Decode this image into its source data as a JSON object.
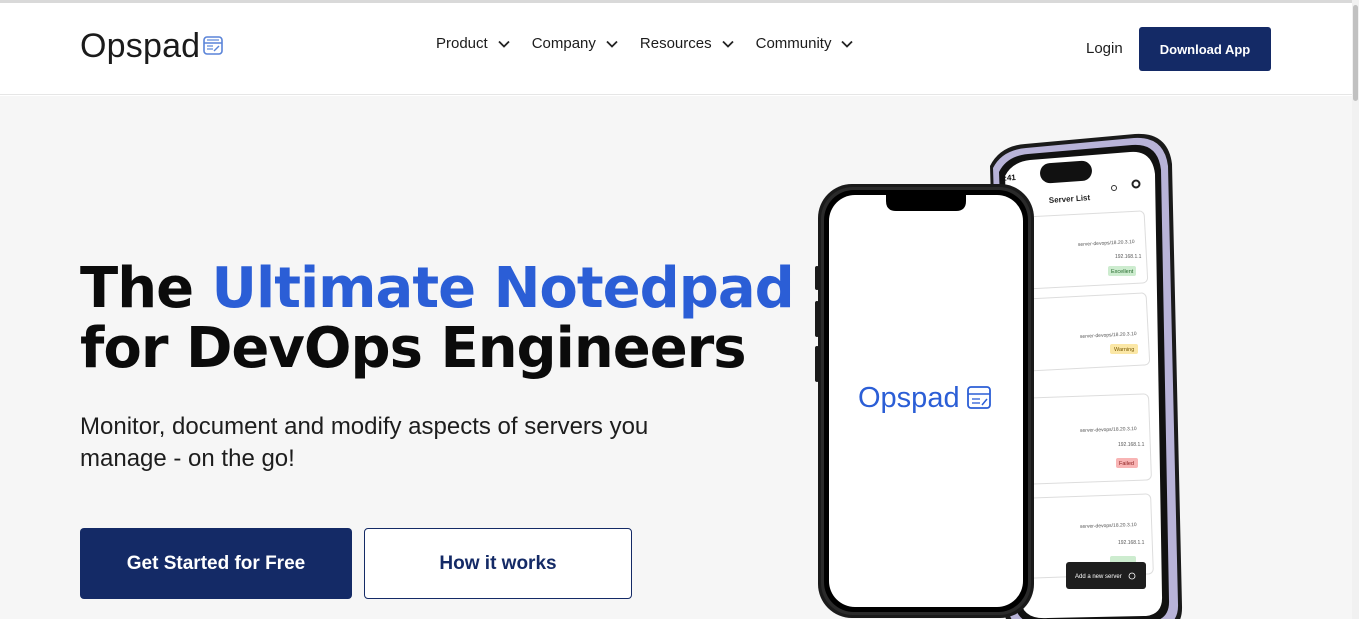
{
  "brand": {
    "name": "Opspad",
    "accent_color": "#2b5ed6",
    "primary_color": "#142a66"
  },
  "nav": {
    "items": [
      {
        "label": "Product",
        "icon": "chevron-down-icon"
      },
      {
        "label": "Company",
        "icon": "chevron-down-icon"
      },
      {
        "label": "Resources",
        "icon": "chevron-down-icon"
      },
      {
        "label": "Community",
        "icon": "chevron-down-icon"
      }
    ],
    "login_label": "Login",
    "download_label": "Download App"
  },
  "hero": {
    "title_part1": "The ",
    "title_accent": "Ultimate Notedpad",
    "title_part2": "for DevOps Engineers",
    "subtitle": "Monitor, document and modify aspects of servers you manage - on the go!",
    "primary_cta": "Get Started for Free",
    "secondary_cta": "How it works"
  },
  "phone_back": {
    "time": "9:41",
    "screen_title": "Server List",
    "servers": [
      {
        "host": "server-devops/18.20.3.10",
        "ip": "192.168.1.1",
        "status": "Excellent",
        "status_color": "#cdeccf"
      },
      {
        "host": "server-devops/18.20.3.10",
        "ip": "192.168.1.1",
        "status": "Warning",
        "status_color": "#fbe7a6"
      },
      {
        "host": "server-devops/18.20.3.10",
        "ip": "192.168.1.1",
        "status": "Failed",
        "status_color": "#f8b4b4"
      },
      {
        "host": "server-devops/18.20.3.10",
        "ip": "192.168.1.1",
        "status": "Excellent",
        "status_color": "#cdeccf"
      }
    ],
    "add_server_label": "Add a new server"
  },
  "phone_front": {
    "logo_text": "Opspad"
  }
}
